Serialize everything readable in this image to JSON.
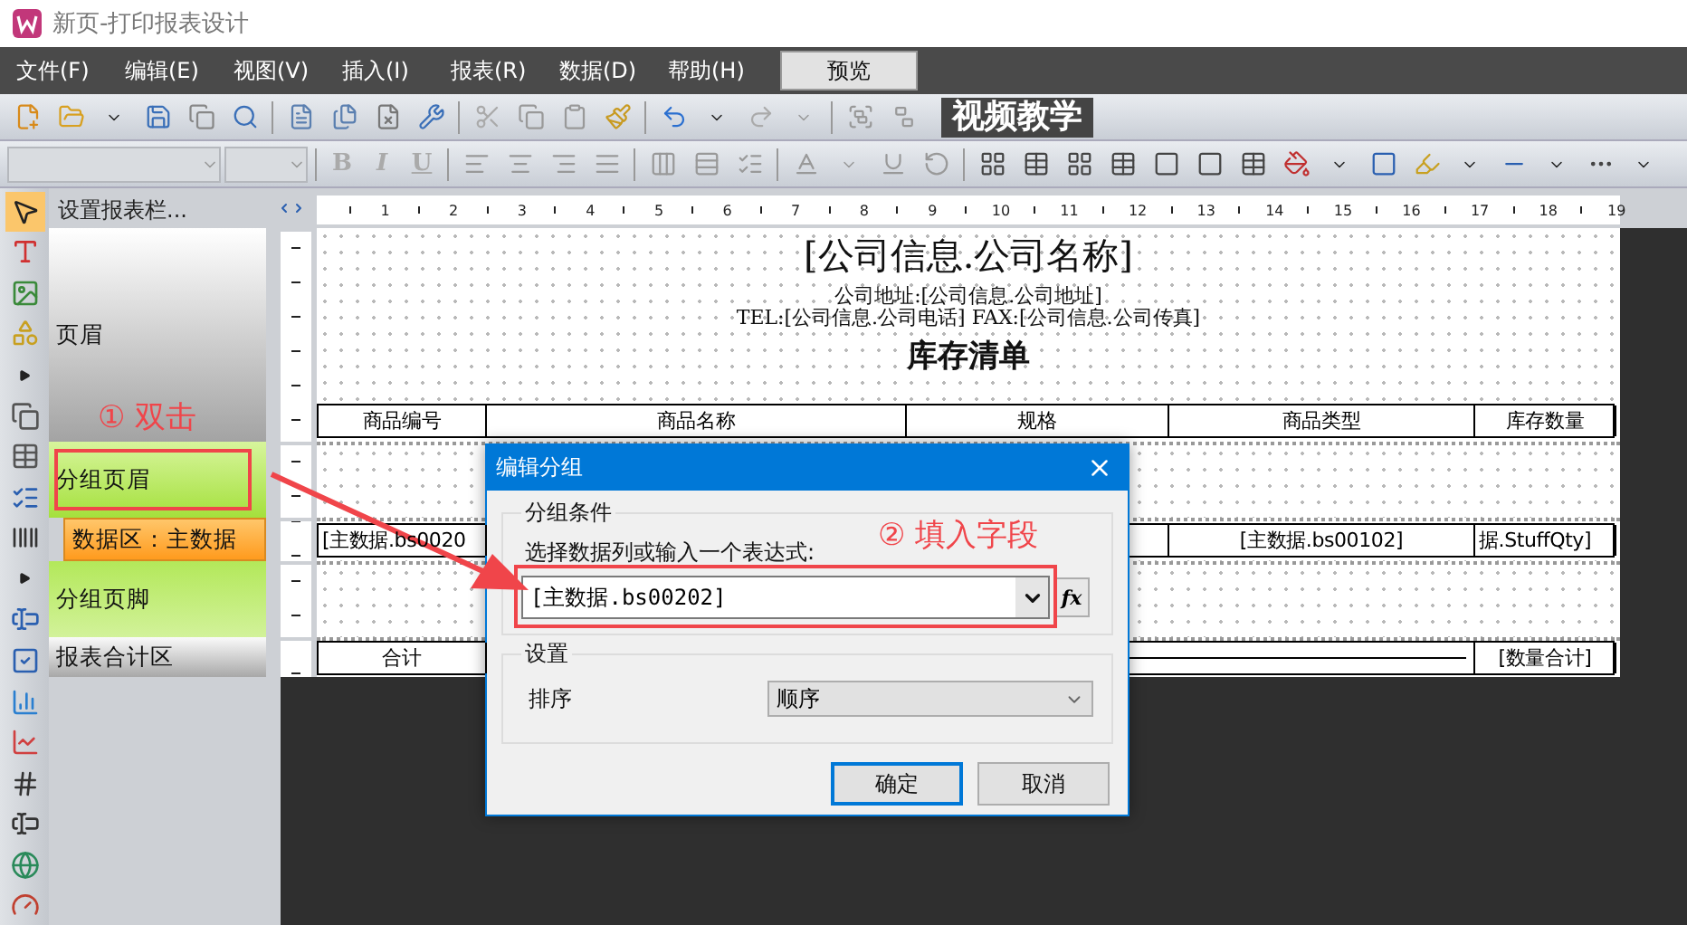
{
  "window": {
    "title": "新页-打印报表设计"
  },
  "menu": [
    {
      "label": "文件(F)"
    },
    {
      "label": "编辑(E)"
    },
    {
      "label": "视图(V)"
    },
    {
      "label": "插入(I)"
    },
    {
      "label": "报表(R)"
    },
    {
      "label": "数据(D)"
    },
    {
      "label": "帮助(H)"
    }
  ],
  "preview_button": {
    "label": "预览"
  },
  "video_tutorial": {
    "label": "视频教学"
  },
  "format_buttons": [
    {
      "label": "B",
      "disabled": true
    },
    {
      "label": "I",
      "disabled": true
    },
    {
      "label": "U",
      "disabled": true
    }
  ],
  "band_panel": {
    "title": "设置报表栏...",
    "bands": [
      {
        "label": "页眉",
        "kind": "page_header"
      },
      {
        "label": "分组页眉",
        "kind": "group_header"
      },
      {
        "label": "数据区：主数据",
        "kind": "data"
      },
      {
        "label": "分组页脚",
        "kind": "group_footer"
      },
      {
        "label": "报表合计区",
        "kind": "summary"
      }
    ]
  },
  "ruler": {
    "ticks": [
      "1",
      "2",
      "3",
      "4",
      "5",
      "6",
      "7",
      "8",
      "9",
      "10",
      "11",
      "12",
      "13",
      "14",
      "15",
      "16",
      "17",
      "18",
      "19"
    ]
  },
  "report": {
    "company_name": "[公司信息.公司名称]",
    "address": "公司地址:[公司信息.公司地址]",
    "contact": "TEL:[公司信息.公司电话]  FAX:[公司信息.公司传真]",
    "title": "库存清单",
    "columns": [
      "商品编号",
      "商品名称",
      "规格",
      "商品类型",
      "库存数量"
    ],
    "data_row": [
      "[主数据.bs0020",
      "[主数据.bs00102]",
      "据.StuffQty]"
    ],
    "total_row": {
      "label": "合计",
      "value": "[数量合计]"
    }
  },
  "dialog": {
    "title": "编辑分组",
    "condition_group": {
      "title": "分组条件",
      "label": "选择数据列或输入一个表达式:",
      "value": "[主数据.bs00202]",
      "formula_button": "fx"
    },
    "settings_group": {
      "title": "设置",
      "sort_label": "排序",
      "sort_value": "顺序"
    },
    "buttons": [
      {
        "label": "确定",
        "kind": "primary"
      },
      {
        "label": "取消",
        "kind": "secondary"
      }
    ]
  },
  "annotations": [
    {
      "text": "① 双击"
    },
    {
      "text": "② 填入字段"
    }
  ]
}
